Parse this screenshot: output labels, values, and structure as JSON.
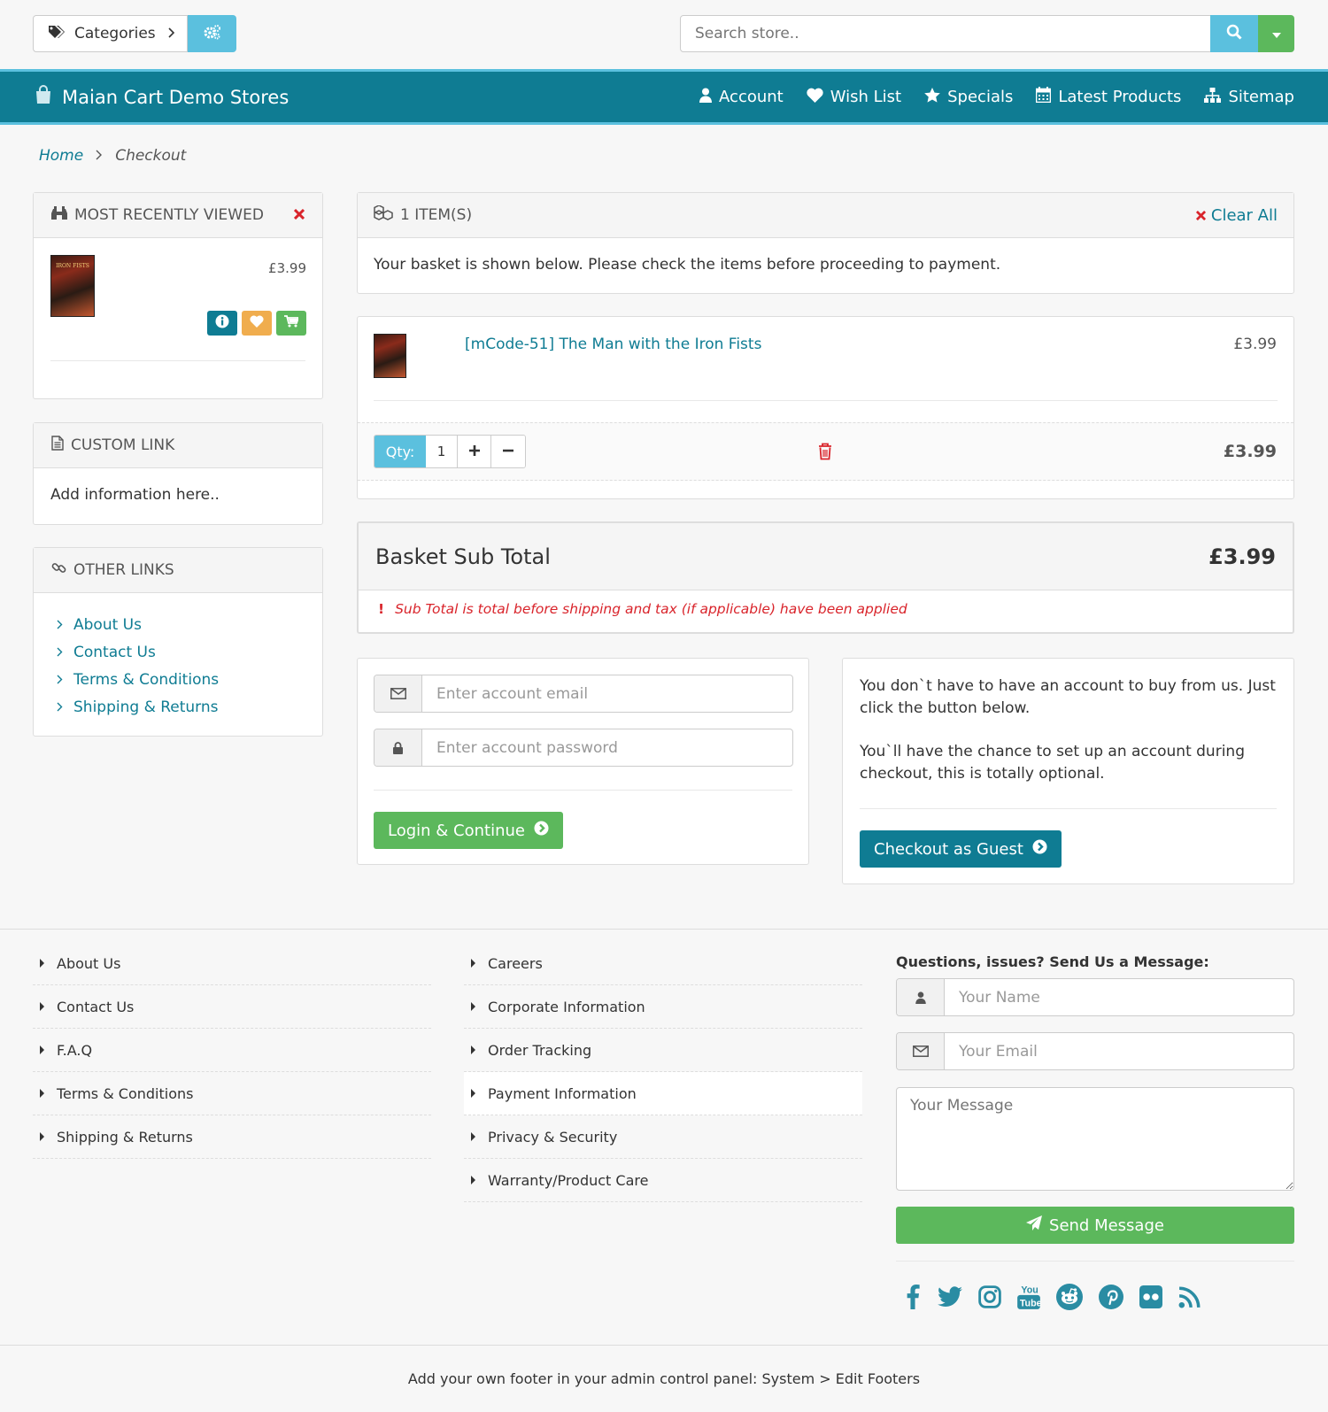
{
  "topbar": {
    "categories_label": "Categories",
    "search_placeholder": "Search store.."
  },
  "nav": {
    "brand": "Maian Cart Demo Stores",
    "items": [
      {
        "label": "Account",
        "icon": "user-icon"
      },
      {
        "label": "Wish List",
        "icon": "heart-icon"
      },
      {
        "label": "Specials",
        "icon": "star-icon"
      },
      {
        "label": "Latest Products",
        "icon": "calendar-icon"
      },
      {
        "label": "Sitemap",
        "icon": "sitemap-icon"
      }
    ]
  },
  "breadcrumb": {
    "home": "Home",
    "current": "Checkout"
  },
  "recent": {
    "title": "MOST RECENTLY VIEWED",
    "price": "£3.99"
  },
  "custom_link": {
    "title": "CUSTOM LINK",
    "body": "Add information here.."
  },
  "other_links": {
    "title": "OTHER LINKS",
    "items": [
      "About Us",
      "Contact Us",
      "Terms & Conditions",
      "Shipping & Returns"
    ]
  },
  "basket": {
    "count_label": "1 ITEM(S)",
    "clear_label": "Clear All",
    "intro": "Your basket is shown below. Please check the items before proceeding to payment.",
    "item_name": "[mCode-51] The Man with the Iron Fists",
    "item_price": "£3.99",
    "qty_label": "Qty:",
    "qty_value": "1",
    "line_total": "£3.99"
  },
  "subtotal": {
    "label": "Basket Sub Total",
    "value": "£3.99",
    "note": "Sub Total is total before shipping and tax (if applicable) have been applied"
  },
  "login": {
    "email_placeholder": "Enter account email",
    "password_placeholder": "Enter account password",
    "button": "Login & Continue"
  },
  "guest": {
    "text1": "You don`t have to have an account to buy from us. Just click the button below.",
    "text2": "You`ll have the chance to set up an account during checkout, this is totally optional.",
    "button": "Checkout as Guest"
  },
  "footer": {
    "col1": [
      "About Us",
      "Contact Us",
      "F.A.Q",
      "Terms & Conditions",
      "Shipping & Returns"
    ],
    "col2": [
      "Careers",
      "Corporate Information",
      "Order Tracking",
      "Payment Information",
      "Privacy & Security",
      "Warranty/Product Care"
    ],
    "contact_title": "Questions, issues? Send Us a Message:",
    "name_placeholder": "Your Name",
    "email_placeholder": "Your Email",
    "message_placeholder": "Your Message",
    "send_label": "Send Message",
    "social": [
      "facebook-icon",
      "twitter-icon",
      "instagram-icon",
      "youtube-icon",
      "reddit-icon",
      "pinterest-icon",
      "flickr-icon",
      "rss-icon"
    ],
    "bottom_text": "Add your own footer in your admin control panel: System > Edit Footers"
  },
  "colors": {
    "primary": "#0f7c93",
    "info": "#5bc0de",
    "success": "#5cb85c",
    "warning": "#f0ad4e",
    "danger": "#d9242b"
  }
}
